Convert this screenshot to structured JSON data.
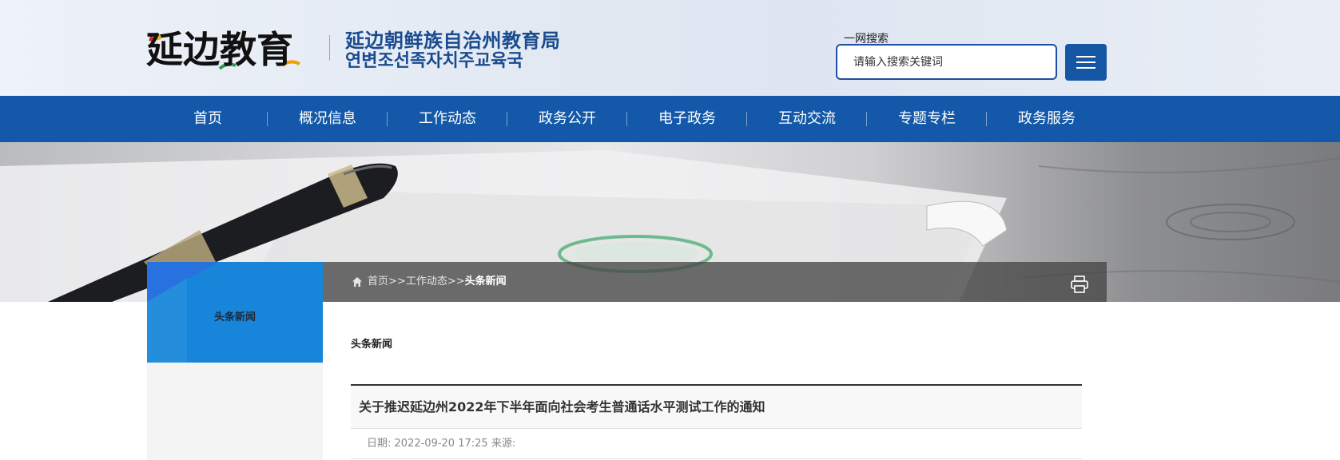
{
  "header": {
    "org_name_cn": "延边朝鲜族自治州教育局",
    "org_name_ko": "연변조선족자치주교육국",
    "logo_text": "延边教育",
    "search": {
      "title": "一网搜索",
      "placeholder": "请输入搜索关键词",
      "value": ""
    },
    "menu_icon": "hamburger-icon"
  },
  "nav": {
    "items": [
      {
        "label": "首页"
      },
      {
        "label": "概况信息"
      },
      {
        "label": "工作动态"
      },
      {
        "label": "政务公开"
      },
      {
        "label": "电子政务"
      },
      {
        "label": "互动交流"
      },
      {
        "label": "专题专栏"
      },
      {
        "label": "政务服务"
      }
    ]
  },
  "breadcrumb": {
    "home": "首页",
    "sep1": ">>",
    "level1": "工作动态",
    "sep2": ">>",
    "current": "头条新闻"
  },
  "sidebar": {
    "title": "头条新闻"
  },
  "main": {
    "section_label": "头条新闻",
    "article": {
      "title": "关于推迟延边州2022年下半年面向社会考生普通话水平测试工作的通知",
      "date_label": "日期:",
      "date": "2022-09-20 17:25",
      "source_label": "来源:",
      "source": ""
    }
  },
  "colors": {
    "nav_bg": "#1459a9",
    "brand_blue": "#1b4b8f",
    "sidebar_blue": "#1a84d8",
    "menu_button": "#1657a5"
  }
}
